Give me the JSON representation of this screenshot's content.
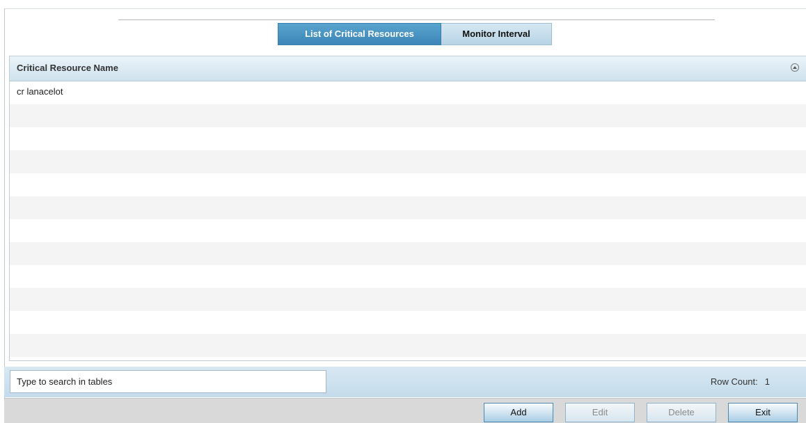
{
  "tabs": [
    {
      "label": "List of Critical Resources",
      "active": true
    },
    {
      "label": "Monitor Interval",
      "active": false
    }
  ],
  "table": {
    "column_header": "Critical Resource Name",
    "rows": [
      "cr lanacelot"
    ]
  },
  "search": {
    "placeholder": "Type to search in tables",
    "value": ""
  },
  "row_count": {
    "label": "Row Count:",
    "value": "1"
  },
  "buttons": {
    "add": "Add",
    "edit": "Edit",
    "delete": "Delete",
    "exit": "Exit"
  },
  "icons": {
    "column_toggle": "collapse-circle-icon"
  },
  "colors": {
    "tab_active": "#3c86b8",
    "tab_inactive": "#c6deee",
    "toolbar": "#cfe2ee"
  }
}
